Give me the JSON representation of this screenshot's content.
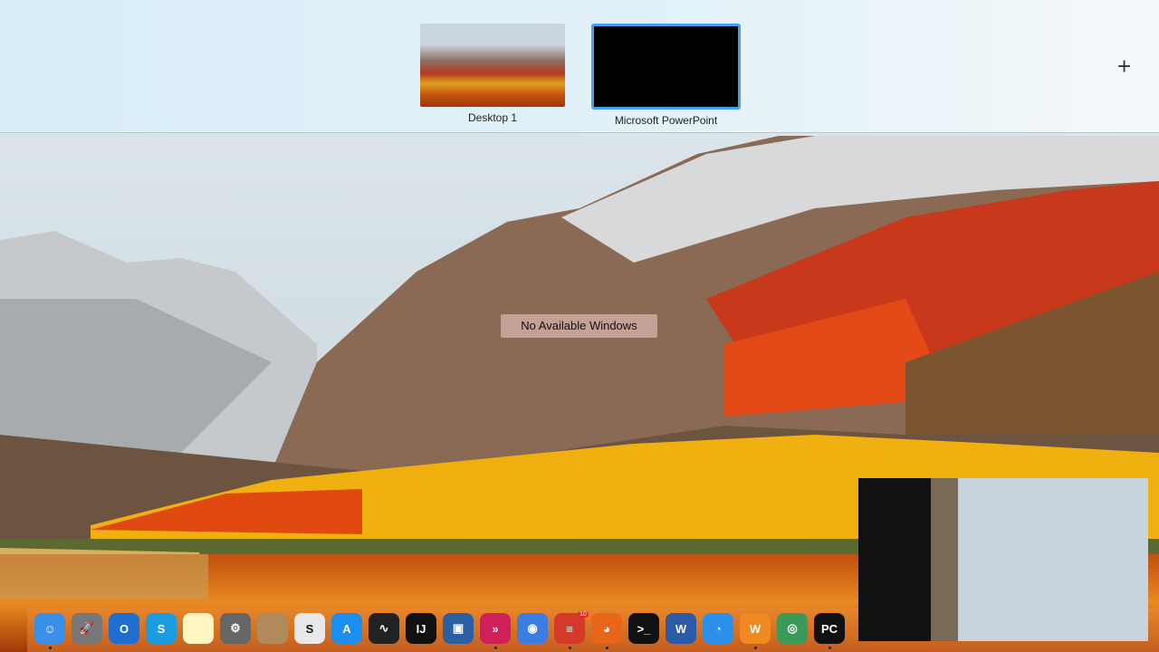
{
  "spaces_bar": {
    "spaces": [
      {
        "label": "Desktop 1",
        "selected": false
      },
      {
        "label": "Microsoft PowerPoint",
        "selected": true
      }
    ],
    "add_space_icon": "+"
  },
  "message": "No Available Windows",
  "dock": {
    "items": [
      {
        "name": "finder",
        "glyph": "☺",
        "color": "#3a8fe8",
        "running": true
      },
      {
        "name": "launchpad",
        "glyph": "🚀",
        "color": "#777",
        "running": false
      },
      {
        "name": "outlook",
        "glyph": "O",
        "color": "#1f6fd0",
        "running": false
      },
      {
        "name": "skype",
        "glyph": "S",
        "color": "#1a9de0",
        "running": false
      },
      {
        "name": "notes",
        "glyph": "",
        "color": "#fdf6c0",
        "running": false
      },
      {
        "name": "system-preferences",
        "glyph": "⚙",
        "color": "#666",
        "running": false
      },
      {
        "name": "notebook",
        "glyph": "",
        "color": "#b08a5a",
        "running": false
      },
      {
        "name": "slack",
        "glyph": "S",
        "color": "#e8e8e8",
        "running": false
      },
      {
        "name": "app-store",
        "glyph": "A",
        "color": "#1a8ff0",
        "running": false
      },
      {
        "name": "activity-monitor",
        "glyph": "∿",
        "color": "#222",
        "running": false
      },
      {
        "name": "intellij",
        "glyph": "IJ",
        "color": "#111",
        "running": false
      },
      {
        "name": "virtualbox",
        "glyph": "▣",
        "color": "#2a5fa0",
        "running": false
      },
      {
        "name": "airmail",
        "glyph": "»",
        "color": "#d0205a",
        "running": true
      },
      {
        "name": "chrome",
        "glyph": "◉",
        "color": "#3b7de0",
        "running": false
      },
      {
        "name": "todoist",
        "glyph": "≡",
        "color": "#d43a2a",
        "running": true,
        "badge": "10"
      },
      {
        "name": "firefox",
        "glyph": "◕",
        "color": "#e8661a",
        "running": true
      },
      {
        "name": "terminal",
        "glyph": ">_",
        "color": "#111",
        "running": false
      },
      {
        "name": "word",
        "glyph": "W",
        "color": "#2b5aa8",
        "running": false
      },
      {
        "name": "tweetbot",
        "glyph": "◔",
        "color": "#2a90e8",
        "running": false
      },
      {
        "name": "orange-app",
        "glyph": "W",
        "color": "#f08a20",
        "running": true
      },
      {
        "name": "anyconnect",
        "glyph": "◎",
        "color": "#3a9a5a",
        "running": false
      },
      {
        "name": "pycharm",
        "glyph": "PC",
        "color": "#111",
        "running": true
      }
    ]
  },
  "colors": {
    "selection": "#4a9ef0",
    "spaces_bar": "#dcedf6"
  }
}
